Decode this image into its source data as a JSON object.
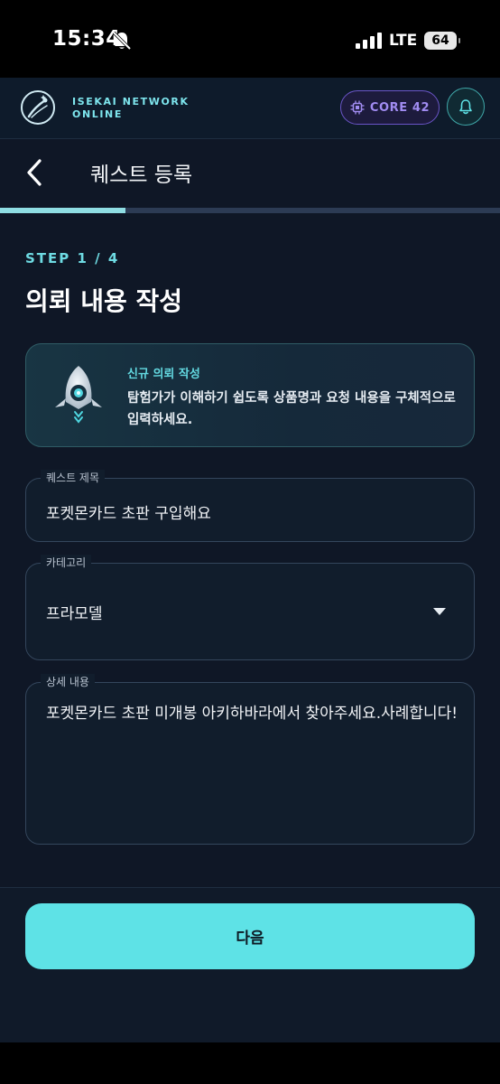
{
  "status_bar": {
    "time": "15:34",
    "network": "LTE",
    "battery": "64",
    "icons": [
      "bell-off-icon",
      "signal-icon"
    ]
  },
  "header": {
    "brand": "ISEKAI NETWORK ONLINE",
    "core_badge": "CORE 42",
    "icons": [
      "logo-icon",
      "chip-icon",
      "bell-icon"
    ]
  },
  "page": {
    "title": "퀘스트 등록",
    "progress": 0.25
  },
  "step": {
    "label": "STEP 1 / 4",
    "title": "의뢰 내용 작성"
  },
  "info_card": {
    "title": "신규 의뢰 작성",
    "body": "탐험가가 이해하기 쉽도록 상품명과 요청 내용을 구체적으로 입력하세요."
  },
  "form": {
    "quest_title": {
      "label": "퀘스트 제목",
      "value": "포켓몬카드 초판 구입해요"
    },
    "category": {
      "label": "카테고리",
      "value": "프라모델"
    },
    "details": {
      "label": "상세 내용",
      "value": "포켓몬카드 초판 미개봉 아키하바라에서 찾아주세요.사례합니다!"
    }
  },
  "actions": {
    "next_label": "다음"
  },
  "colors": {
    "accent": "#5ee2e6",
    "background": "#0f1726",
    "core_badge": "#a18cf2"
  }
}
